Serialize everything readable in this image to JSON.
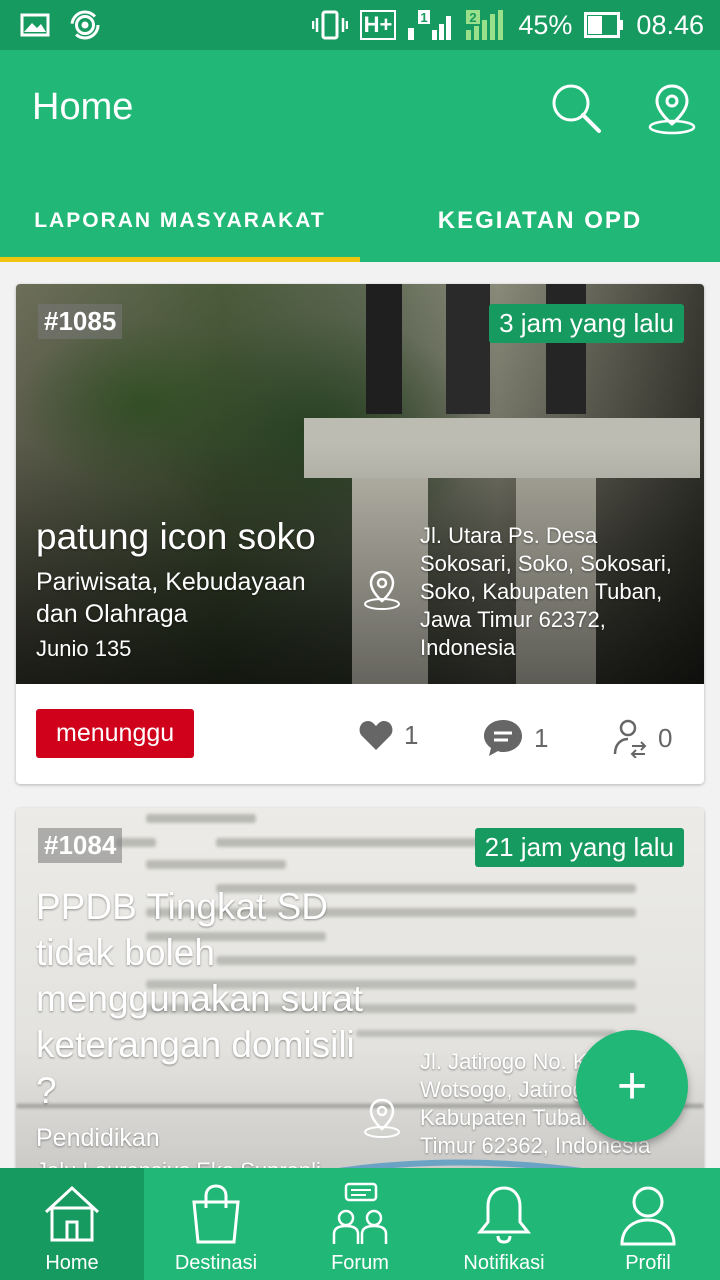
{
  "status_bar": {
    "network": "H+",
    "sim1": "1",
    "sim2": "2",
    "battery": "45%",
    "time": "08.46"
  },
  "app_bar": {
    "title": "Home",
    "icons": [
      "search-icon",
      "location-icon"
    ]
  },
  "tabs": [
    {
      "label": "LAPORAN MASYARAKAT",
      "active": true
    },
    {
      "label": "KEGIATAN OPD",
      "active": false
    }
  ],
  "reports": [
    {
      "id": "#1085",
      "time": "3 jam yang lalu",
      "title": "patung icon soko",
      "category": "Pariwisata, Kebudayaan dan Olahraga",
      "user": "Junio 135",
      "address": "Jl. Utara Ps. Desa Sokosari, Soko, Sokosari, Soko, Kabupaten Tuban, Jawa Timur 62372, Indonesia",
      "status": "menunggu",
      "likes": "1",
      "comments": "1",
      "supports": "0"
    },
    {
      "id": "#1084",
      "time": "21 jam yang lalu",
      "title": "PPDB Tingkat SD tidak boleh menggunakan surat keterangan domisili ?",
      "category": "Pendidikan",
      "user": "Jalu Laurensius Eko Supranli",
      "address": "Jl. Jatirogo No. Klagon, Wotsogo, Jatirogo, Kabupaten Tuban, Jawa Timur 62362, Indonesia"
    }
  ],
  "fab": {
    "label": "+"
  },
  "bottom_nav": [
    {
      "label": "Home",
      "icon": "home-icon",
      "active": true
    },
    {
      "label": "Destinasi",
      "icon": "shopping-bag-icon",
      "active": false
    },
    {
      "label": "Forum",
      "icon": "forum-icon",
      "active": false
    },
    {
      "label": "Notifikasi",
      "icon": "bell-icon",
      "active": false
    },
    {
      "label": "Profil",
      "icon": "profile-icon",
      "active": false
    }
  ],
  "colors": {
    "primary": "#21b877",
    "primary_dark": "#179a5f",
    "accent": "#f1c40f",
    "status_waiting": "#d0021b"
  }
}
